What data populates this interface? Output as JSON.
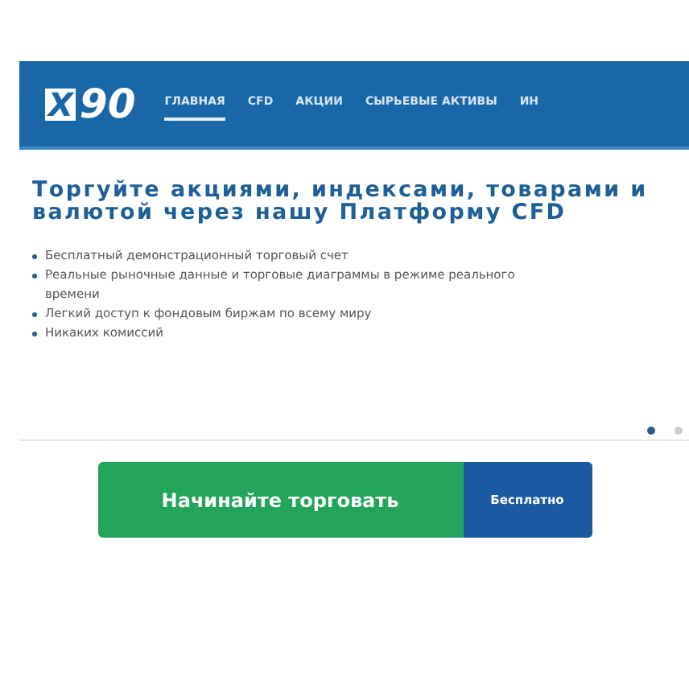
{
  "header": {
    "logo": {
      "mark": "X",
      "text": "90"
    },
    "nav": [
      {
        "label": "ГЛАВНАЯ",
        "selected": true
      },
      {
        "label": "CFD",
        "selected": false
      },
      {
        "label": "АКЦИИ",
        "selected": false
      },
      {
        "label": "СЫРЬЕВЫЕ АКТИВЫ",
        "selected": false
      },
      {
        "label": "ИН",
        "selected": false
      }
    ]
  },
  "headline": "Торгуйте акциями, индексами, товарами и валютой через нашу Платформу CFD",
  "features": [
    "Бесплатный демонстрационный торговый счет",
    "Реальные рыночные данные и торговые диаграммы в режиме реального времени",
    "Легкий доступ к фондовым биржам по всему миру",
    "Никаких комиссий"
  ],
  "slider_dots": [
    {
      "selected": true
    },
    {
      "selected": false
    }
  ],
  "cta": {
    "label": "Начинайте торговать",
    "badge": "Бесплатно"
  }
}
